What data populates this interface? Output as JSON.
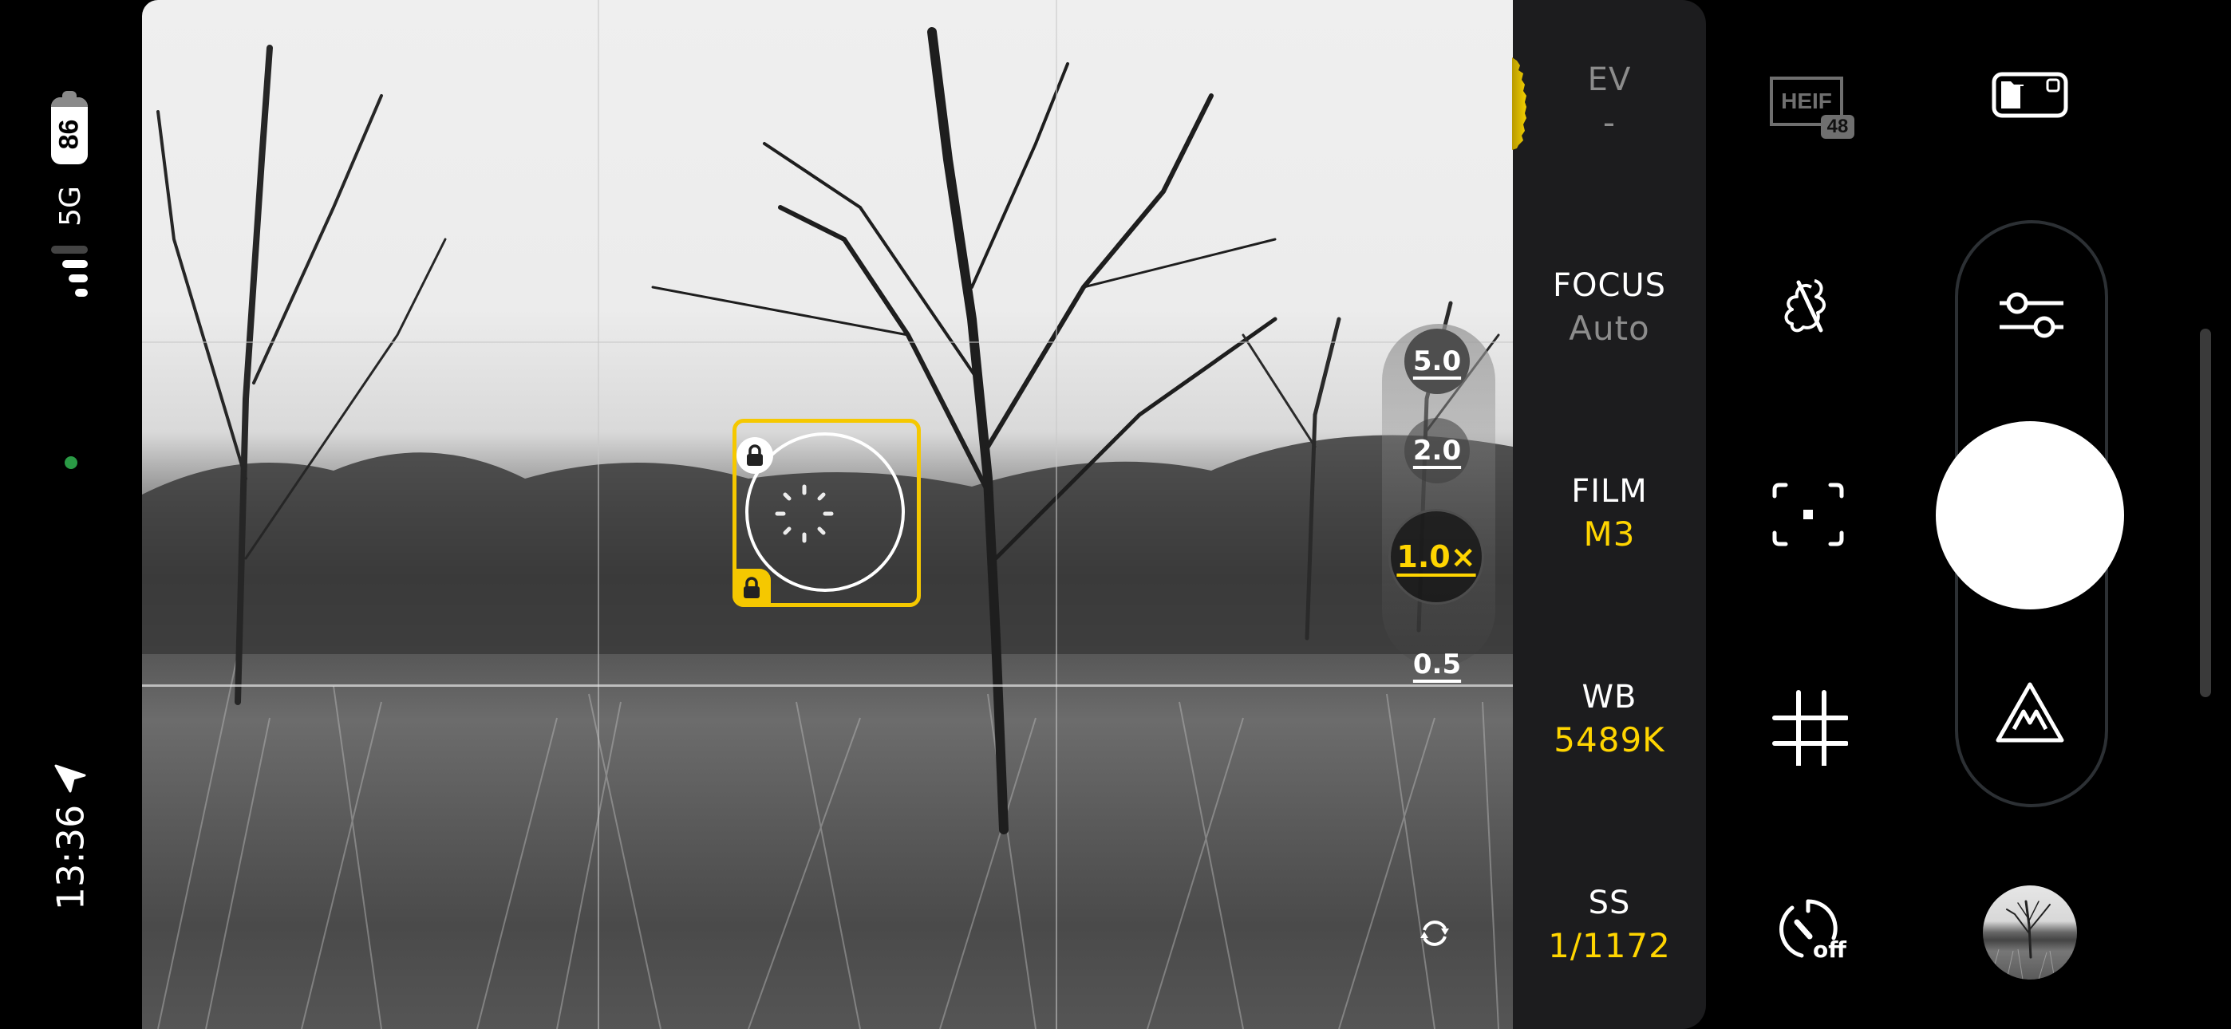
{
  "status_bar": {
    "battery_percent": "86",
    "network": "5G",
    "signal_bars": 3,
    "signal_bars_max": 4,
    "privacy_indicator_color": "#2a9a45",
    "time": "13:36",
    "location_icon": "location-arrow-icon"
  },
  "viewfinder": {
    "grid": "rule-of-thirds",
    "focus_locked": true,
    "exposure_locked": true,
    "zoom_options": [
      {
        "label": "5.0",
        "selected": false
      },
      {
        "label": "2.0",
        "selected": false
      },
      {
        "label": "1.0×",
        "selected": true
      },
      {
        "label": "0.5",
        "selected": false
      }
    ],
    "switch_camera_icon": "rotate-camera-icon"
  },
  "settings_panel": {
    "ev": {
      "label": "EV",
      "value": "-"
    },
    "focus": {
      "label": "FOCUS",
      "value": "Auto"
    },
    "film": {
      "label": "FILM",
      "value": "M3"
    },
    "wb": {
      "label": "WB",
      "value": "5489K"
    },
    "ss": {
      "label": "SS",
      "value": "1/1172"
    }
  },
  "controls": {
    "format": {
      "label": "HEIF",
      "badge": "48"
    },
    "timer": {
      "label": "off"
    },
    "accent_color": "#ffd500"
  }
}
